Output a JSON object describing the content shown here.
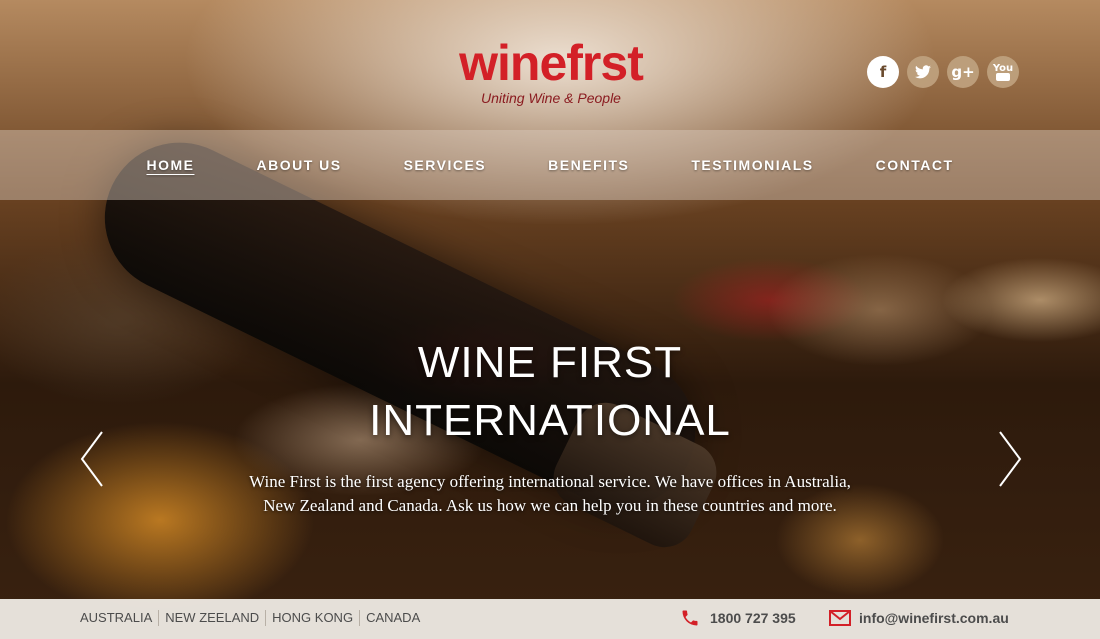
{
  "brand": {
    "name": "winefrst",
    "tagline": "Uniting Wine & People",
    "accent_color": "#d32027"
  },
  "social": [
    {
      "label": "f",
      "icon": "facebook-icon"
    },
    {
      "label": "t",
      "icon": "twitter-icon"
    },
    {
      "label": "g+",
      "icon": "google-plus-icon"
    },
    {
      "label": "You",
      "icon": "youtube-icon"
    }
  ],
  "nav": {
    "items": [
      {
        "label": "HOME",
        "active": true
      },
      {
        "label": "ABOUT US"
      },
      {
        "label": "SERVICES"
      },
      {
        "label": "BENEFITS"
      },
      {
        "label": "TESTIMONIALS"
      },
      {
        "label": "CONTACT"
      }
    ]
  },
  "hero": {
    "title_line1": "WINE FIRST",
    "title_line2": "INTERNATIONAL",
    "text_line1": "Wine First is the first agency offering international service. We have offices in Australia,",
    "text_line2": "New Zealand and Canada. Ask us how we can help you in these countries and more.",
    "prev_icon": "chevron-left-icon",
    "next_icon": "chevron-right-icon"
  },
  "footer": {
    "countries": [
      "AUSTRALIA",
      "NEW ZEELAND",
      "HONG KONG",
      "CANADA"
    ],
    "phone": "1800 727 395",
    "email": "info@winefirst.com.au",
    "icon_color": "#d32027"
  }
}
